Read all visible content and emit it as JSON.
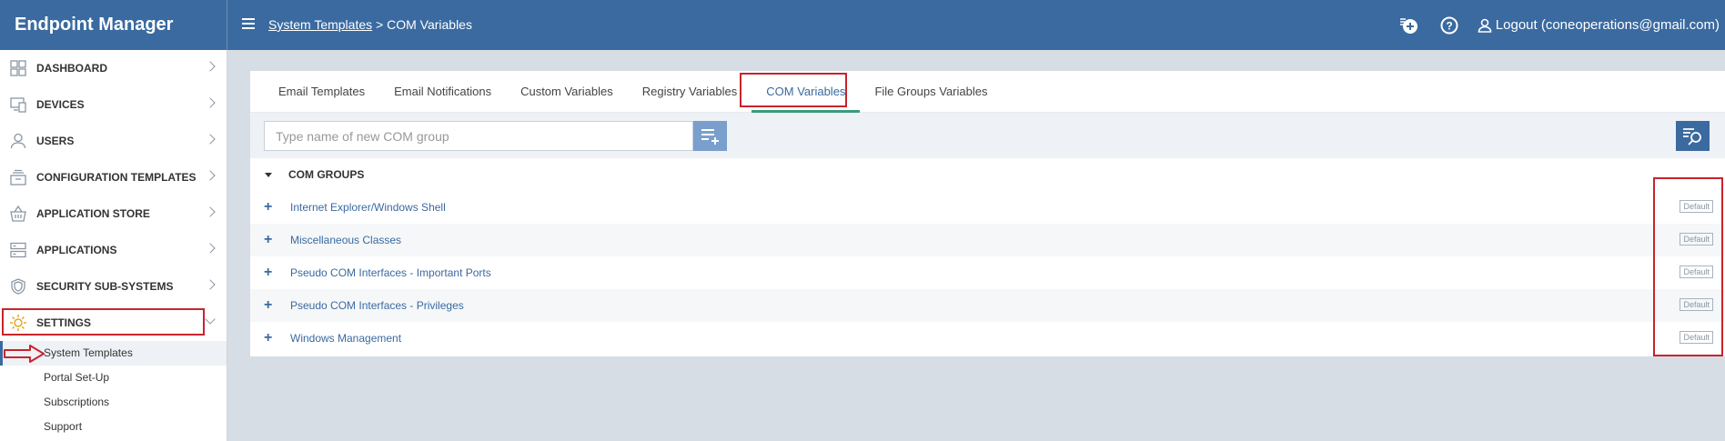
{
  "brand": "Endpoint Manager",
  "breadcrumb": {
    "parent": "System Templates",
    "separator": ">",
    "current": "COM Variables"
  },
  "header": {
    "logout": "Logout (coneoperations@gmail.com)"
  },
  "sidebar": {
    "items": [
      {
        "label": "DASHBOARD",
        "icon": "dashboard-icon"
      },
      {
        "label": "DEVICES",
        "icon": "devices-icon"
      },
      {
        "label": "USERS",
        "icon": "user-icon"
      },
      {
        "label": "CONFIGURATION TEMPLATES",
        "icon": "templates-icon"
      },
      {
        "label": "APPLICATION STORE",
        "icon": "basket-icon"
      },
      {
        "label": "APPLICATIONS",
        "icon": "applications-icon"
      },
      {
        "label": "SECURITY SUB-SYSTEMS",
        "icon": "shield-icon"
      },
      {
        "label": "SETTINGS",
        "icon": "gear-icon"
      }
    ],
    "sub_items": [
      {
        "label": "System Templates"
      },
      {
        "label": "Portal Set-Up"
      },
      {
        "label": "Subscriptions"
      },
      {
        "label": "Support"
      }
    ]
  },
  "tabs": [
    {
      "label": "Email Templates"
    },
    {
      "label": "Email Notifications"
    },
    {
      "label": "Custom Variables"
    },
    {
      "label": "Registry Variables"
    },
    {
      "label": "COM Variables"
    },
    {
      "label": "File Groups Variables"
    }
  ],
  "search": {
    "placeholder": "Type name of new COM group"
  },
  "groups": {
    "header": "COM GROUPS",
    "rows": [
      {
        "name": "Internet Explorer/Windows Shell",
        "badge": "Default"
      },
      {
        "name": "Miscellaneous Classes",
        "badge": "Default"
      },
      {
        "name": "Pseudo COM Interfaces - Important Ports",
        "badge": "Default"
      },
      {
        "name": "Pseudo COM Interfaces - Privileges",
        "badge": "Default"
      },
      {
        "name": "Windows Management",
        "badge": "Default"
      }
    ]
  },
  "colors": {
    "header_bg": "#3a6aa0",
    "highlight_red": "#c8242c",
    "active_tab_underline": "#3a9c7a",
    "settings_icon": "#e5a72a"
  }
}
